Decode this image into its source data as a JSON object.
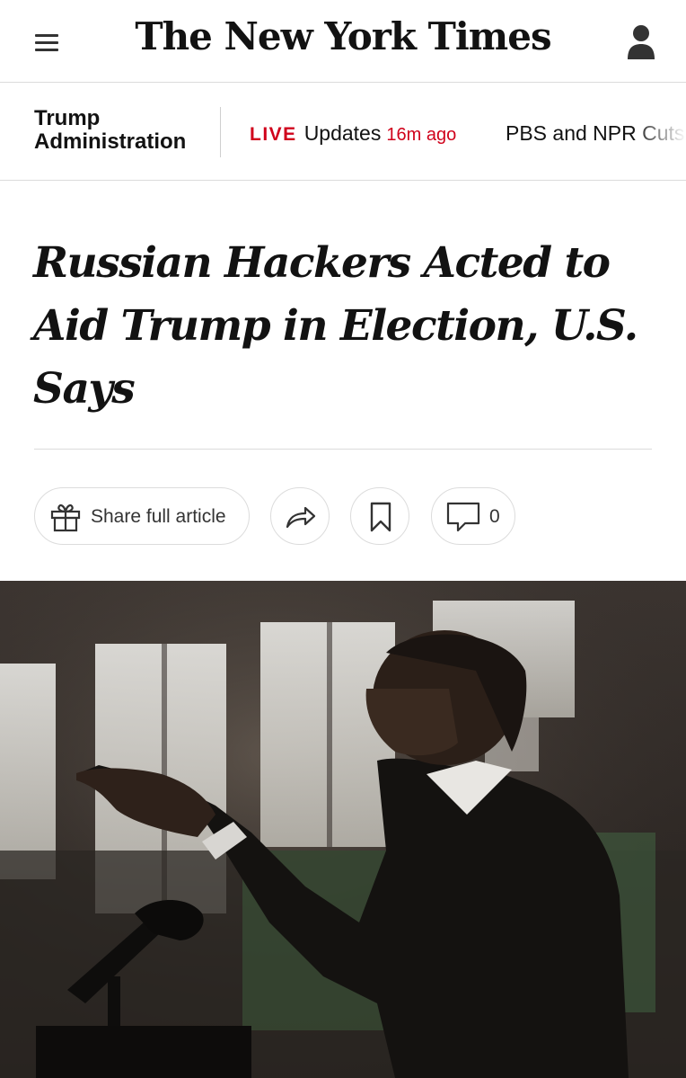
{
  "masthead": {
    "logo": "The New York Times",
    "menu_icon": "hamburger-menu-icon",
    "account_icon": "user-account-icon"
  },
  "section_bar": {
    "section_title_line1": "Trump",
    "section_title_line2": "Administration",
    "live_tag": "LIVE",
    "live_label": "Updates",
    "live_time": "16m ago",
    "next_link": "PBS and NPR Cuts"
  },
  "article": {
    "headline": "Russian Hackers Acted to Aid Trump in Election, U.S. Says"
  },
  "tools": {
    "share_full_label": "Share full article",
    "comment_count": "0",
    "gift_icon": "gift-icon",
    "share_icon": "share-arrow-icon",
    "bookmark_icon": "bookmark-icon",
    "comment_icon": "comment-bubble-icon"
  },
  "colors": {
    "accent_red": "#d0021b",
    "text": "#121212",
    "rule": "#dcdcdc"
  }
}
